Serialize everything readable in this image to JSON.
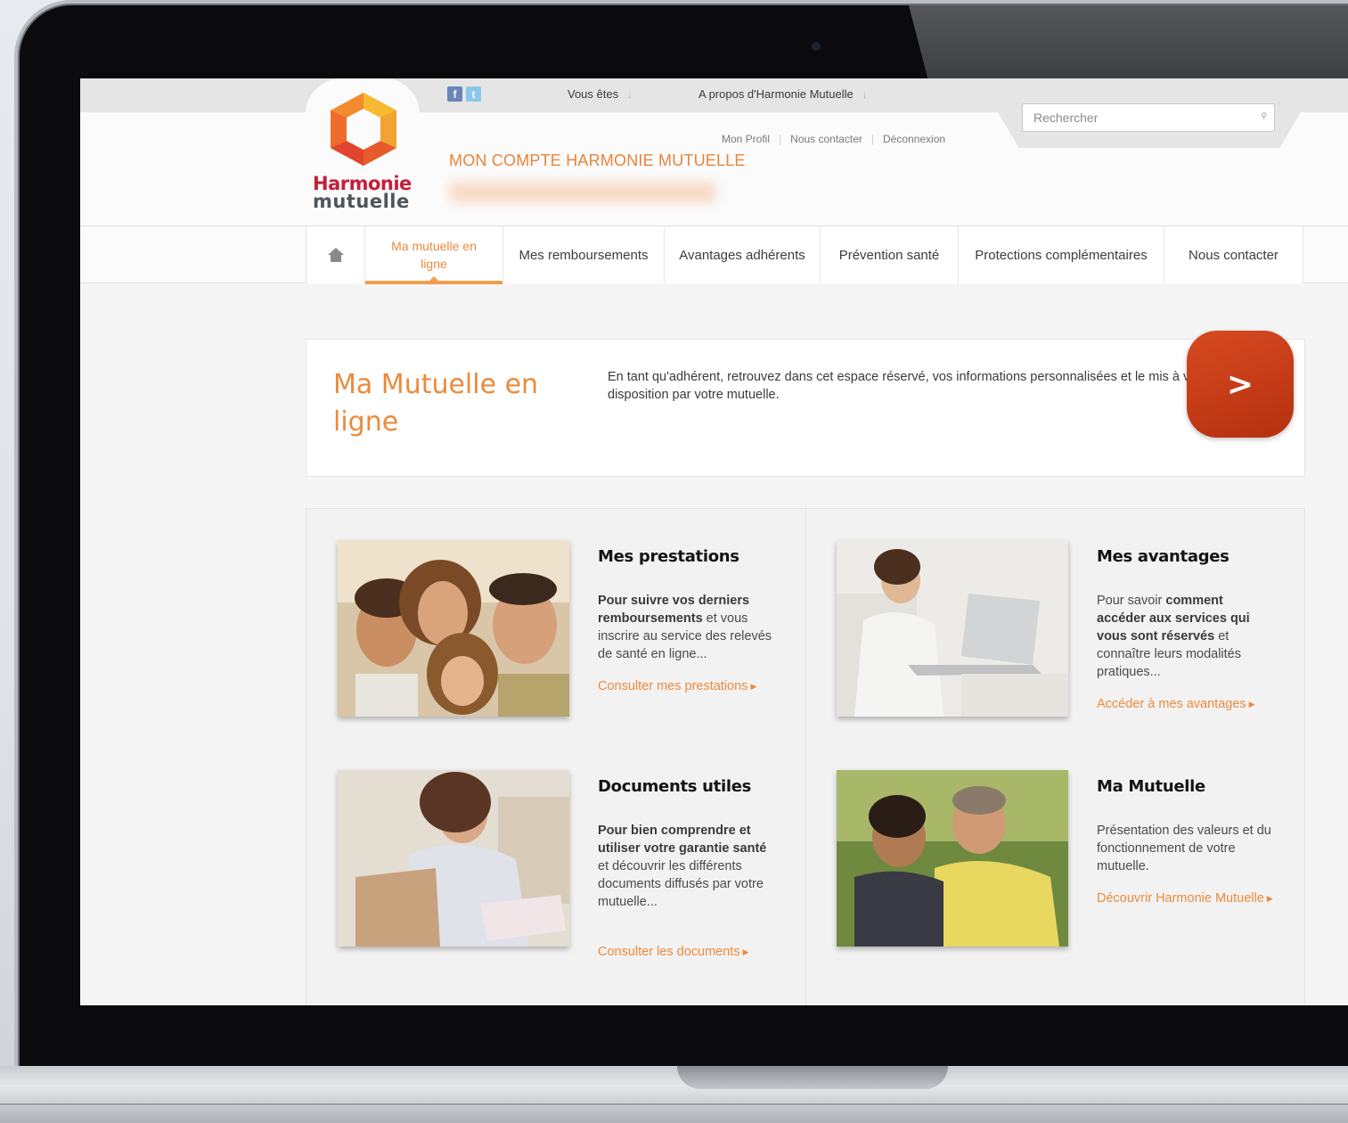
{
  "topbar": {
    "menu1": "Vous êtes",
    "menu2": "A propos d'Harmonie Mutuelle",
    "arrow": "↓",
    "social": [
      "f",
      "t"
    ]
  },
  "logo": {
    "line1": "Harmonie",
    "line2": "mutuelle"
  },
  "search": {
    "placeholder": "Rechercher"
  },
  "account": {
    "links": [
      "Mon Profil",
      "Nous contacter",
      "Déconnexion"
    ],
    "title": "MON COMPTE HARMONIE MUTUELLE"
  },
  "nav": {
    "items": [
      {
        "label": "Ma mutuelle en ligne",
        "active": true
      },
      {
        "label": "Mes remboursements"
      },
      {
        "label": "Avantages adhérents"
      },
      {
        "label": "Prévention santé"
      },
      {
        "label": "Protections complémentaires"
      },
      {
        "label": "Nous contacter"
      }
    ]
  },
  "intro": {
    "title": "Ma Mutuelle en ligne",
    "text": "En tant qu'adhérent, retrouvez dans cet espace réservé, vos informations personnalisées et le mis à votre disposition par votre mutuelle."
  },
  "play_button": {
    "label": ">"
  },
  "cards": [
    {
      "title": "Mes prestations",
      "text_bold": "Pour suivre vos derniers remboursements",
      "text_rest": " et vous inscrire au service des relevés de santé en ligne...",
      "link": "Consulter mes prestations"
    },
    {
      "title": "Mes avantages",
      "text_pre": "Pour savoir ",
      "text_bold": "comment accéder aux services qui vous sont réservés",
      "text_rest": " et connaître leurs modalités pratiques...",
      "link": "Accéder à mes avantages"
    },
    {
      "title": "Documents utiles",
      "text_bold": "Pour bien comprendre et utiliser votre garantie santé",
      "text_rest": " et découvrir les différents documents diffusés par votre mutuelle...",
      "link": "Consulter les documents"
    },
    {
      "title": "Ma Mutuelle",
      "text_rest": "Présentation des valeurs et du fonctionnement de votre mutuelle.",
      "link": "Découvrir Harmonie Mutuelle"
    }
  ],
  "colors": {
    "accent": "#ec8a3c",
    "logo_red": "#c61e39",
    "play": "#c73a17"
  },
  "icons": [
    "home-icon",
    "facebook-icon",
    "twitter-icon",
    "search-icon",
    "chevron-right-icon",
    "play-icon"
  ]
}
